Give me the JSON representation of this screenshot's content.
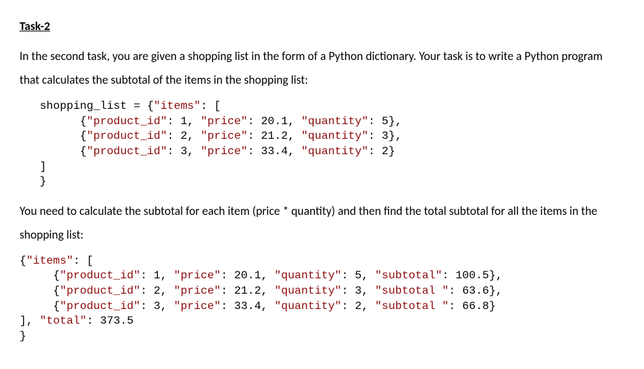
{
  "heading": "Task-2",
  "para1": "In the second task, you are given a shopping list in the form of a Python dictionary. Your task is to write a Python program that calculates the subtotal of the items in the shopping list:",
  "code1": {
    "assign_var": "shopping_list",
    "items_key": "\"items\"",
    "rows": [
      {
        "pid_k": "\"product_id\"",
        "pid_v": "1",
        "price_k": "\"price\"",
        "price_v": "20.1",
        "qty_k": "\"quantity\"",
        "qty_v": "5"
      },
      {
        "pid_k": "\"product_id\"",
        "pid_v": "2",
        "price_k": "\"price\"",
        "price_v": "21.2",
        "qty_k": "\"quantity\"",
        "qty_v": "3"
      },
      {
        "pid_k": "\"product_id\"",
        "pid_v": "3",
        "price_k": "\"price\"",
        "price_v": "33.4",
        "qty_k": "\"quantity\"",
        "qty_v": "2"
      }
    ]
  },
  "para2": "You need to calculate the subtotal for each item (price * quantity) and then find the total subtotal for all the items in the shopping list:",
  "code2": {
    "items_key": "\"items\"",
    "rows": [
      {
        "pid_k": "\"product_id\"",
        "pid_v": "1",
        "price_k": "\"price\"",
        "price_v": "20.1",
        "qty_k": "\"quantity\"",
        "qty_v": "5",
        "sub_k": "\"subtotal\"",
        "sub_v": "100.5"
      },
      {
        "pid_k": "\"product_id\"",
        "pid_v": "2",
        "price_k": "\"price\"",
        "price_v": "21.2",
        "qty_k": "\"quantity\"",
        "qty_v": "3",
        "sub_k": "\"subtotal \"",
        "sub_v": "63.6"
      },
      {
        "pid_k": "\"product_id\"",
        "pid_v": "3",
        "price_k": "\"price\"",
        "price_v": "33.4",
        "qty_k": "\"quantity\"",
        "qty_v": "2",
        "sub_k": "\"subtotal \"",
        "sub_v": "66.8"
      }
    ],
    "total_key": "\"total\"",
    "total_val": "373.5"
  }
}
